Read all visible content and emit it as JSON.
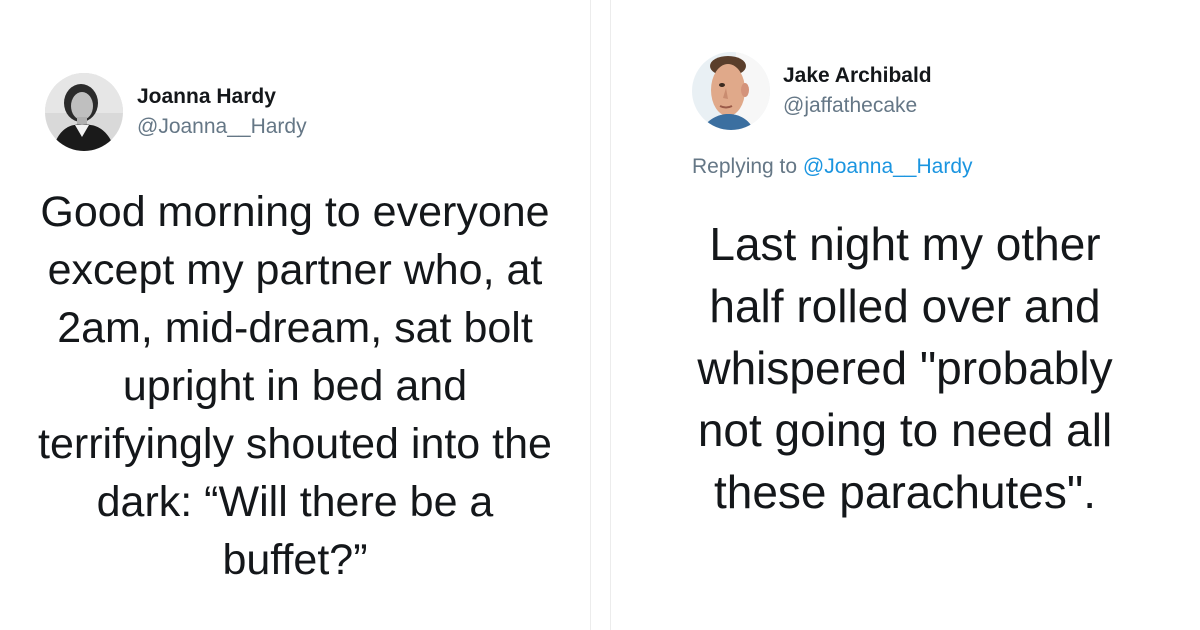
{
  "tweets": [
    {
      "avatar_icon": "avatar-woman-portrait",
      "name": "Joanna Hardy",
      "handle": "@Joanna__Hardy",
      "text": "Good morning to everyone\nexcept my partner who, at\n2am, mid-dream, sat bolt\nupright in bed and\nterrifyingly shouted into the\ndark: “Will there be a\nbuffet?”"
    },
    {
      "avatar_icon": "avatar-man-portrait",
      "name": "Jake Archibald",
      "handle": "@jaffathecake",
      "replying_prefix": "Replying to ",
      "replying_to": "@Joanna__Hardy",
      "text": "Last night my other\nhalf rolled over and\nwhispered \"probably\nnot going to need all\nthese parachutes\"."
    }
  ],
  "colors": {
    "name": "#14171a",
    "handle": "#657786",
    "mention": "#1b95e0",
    "background": "#ffffff"
  }
}
